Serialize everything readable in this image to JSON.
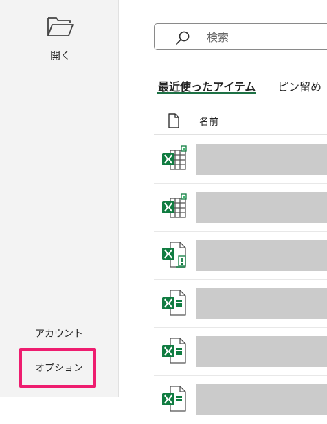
{
  "sidebar": {
    "open": {
      "label": "開く",
      "icon": "folder-icon"
    },
    "items": [
      {
        "label": "アカウント"
      },
      {
        "label": "オプション",
        "highlighted": true,
        "highlight_color": "#ee1d6f"
      }
    ]
  },
  "search": {
    "placeholder": "検索",
    "icon": "search-icon"
  },
  "tabs": [
    {
      "label": "最近使ったアイテム",
      "active": true
    },
    {
      "label": "ピン留め",
      "active": false
    }
  ],
  "file_list": {
    "column_header": {
      "icon": "document-icon",
      "label": "名前"
    },
    "rows": [
      {
        "icon": "excel-workbook-icon"
      },
      {
        "icon": "excel-workbook-icon"
      },
      {
        "icon": "excel-template-icon"
      },
      {
        "icon": "excel-file-icon"
      },
      {
        "icon": "excel-file-icon"
      },
      {
        "icon": "excel-file-icon"
      }
    ]
  },
  "colors": {
    "accent": "#1e7145",
    "excel_green": "#107c41",
    "highlight": "#ee1d6f"
  }
}
